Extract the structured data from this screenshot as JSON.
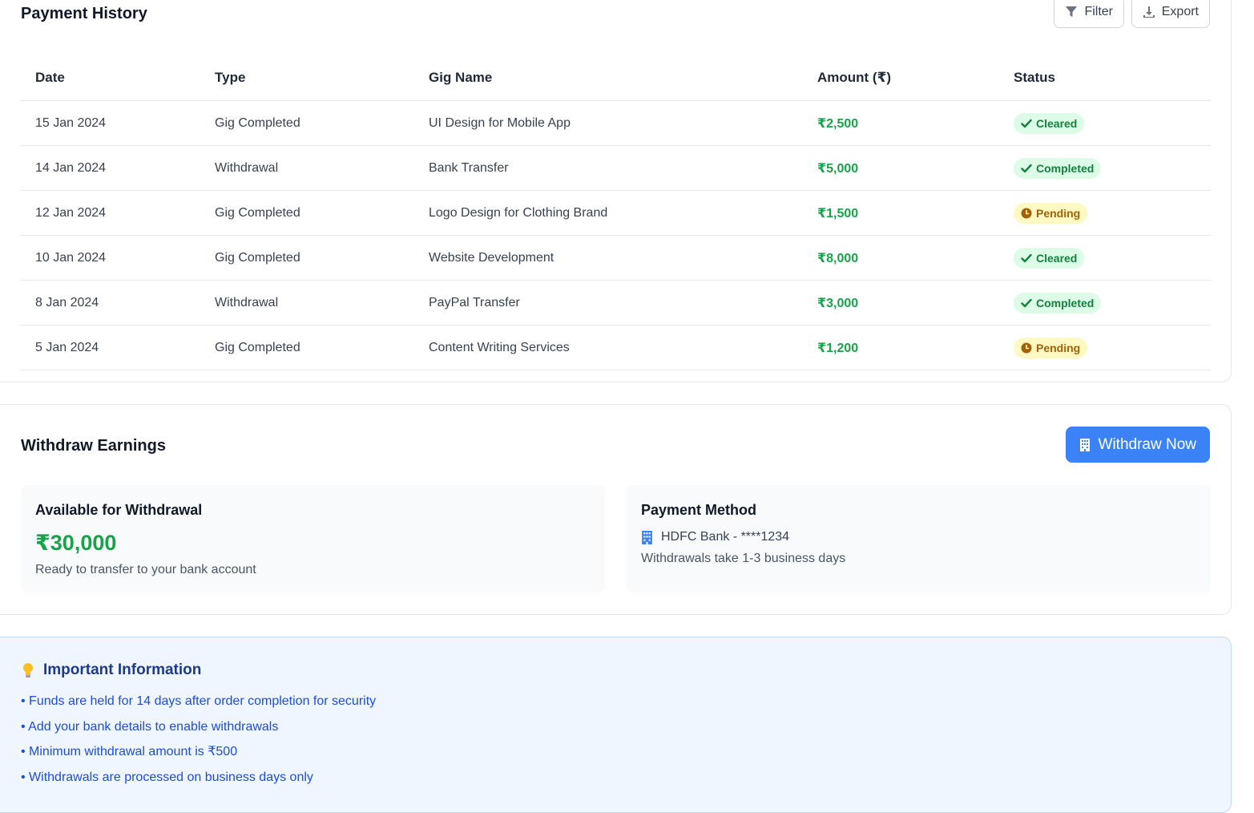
{
  "history": {
    "title": "Payment History",
    "filter_label": "Filter",
    "export_label": "Export",
    "columns": [
      "Date",
      "Type",
      "Gig Name",
      "Amount (₹)",
      "Status"
    ],
    "rows": [
      {
        "date": "15 Jan 2024",
        "type": "Gig Completed",
        "gig": "UI Design for Mobile App",
        "amount": "₹2,500",
        "status": "Cleared",
        "status_kind": "ok"
      },
      {
        "date": "14 Jan 2024",
        "type": "Withdrawal",
        "gig": "Bank Transfer",
        "amount": "₹5,000",
        "status": "Completed",
        "status_kind": "ok"
      },
      {
        "date": "12 Jan 2024",
        "type": "Gig Completed",
        "gig": "Logo Design for Clothing Brand",
        "amount": "₹1,500",
        "status": "Pending",
        "status_kind": "pending"
      },
      {
        "date": "10 Jan 2024",
        "type": "Gig Completed",
        "gig": "Website Development",
        "amount": "₹8,000",
        "status": "Cleared",
        "status_kind": "ok"
      },
      {
        "date": "8 Jan 2024",
        "type": "Withdrawal",
        "gig": "PayPal Transfer",
        "amount": "₹3,000",
        "status": "Completed",
        "status_kind": "ok"
      },
      {
        "date": "5 Jan 2024",
        "type": "Gig Completed",
        "gig": "Content Writing Services",
        "amount": "₹1,200",
        "status": "Pending",
        "status_kind": "pending"
      }
    ]
  },
  "withdraw": {
    "title": "Withdraw Earnings",
    "button_label": "Withdraw Now",
    "available": {
      "title": "Available for Withdrawal",
      "amount": "₹30,000",
      "note": "Ready to transfer to your bank account"
    },
    "method": {
      "title": "Payment Method",
      "bank": "HDFC Bank - ****1234",
      "note": "Withdrawals take 1-3 business days"
    }
  },
  "info": {
    "title": "Important Information",
    "items": [
      "• Funds are held for 14 days after order completion for security",
      "• Add your bank details to enable withdrawals",
      "• Minimum withdrawal amount is ₹500",
      "• Withdrawals are processed on business days only"
    ]
  },
  "icons": {
    "filter": "filter-icon",
    "export": "download-icon",
    "ok": "check-icon",
    "pending": "clock-icon",
    "bank": "building-icon",
    "info": "lightbulb-icon"
  },
  "colors": {
    "amount": "#16a34a",
    "primary": "#3b82f6",
    "badge_ok_bg": "#dcfce7",
    "badge_pending_bg": "#fef9c3",
    "info_bg": "#eff6ff"
  }
}
